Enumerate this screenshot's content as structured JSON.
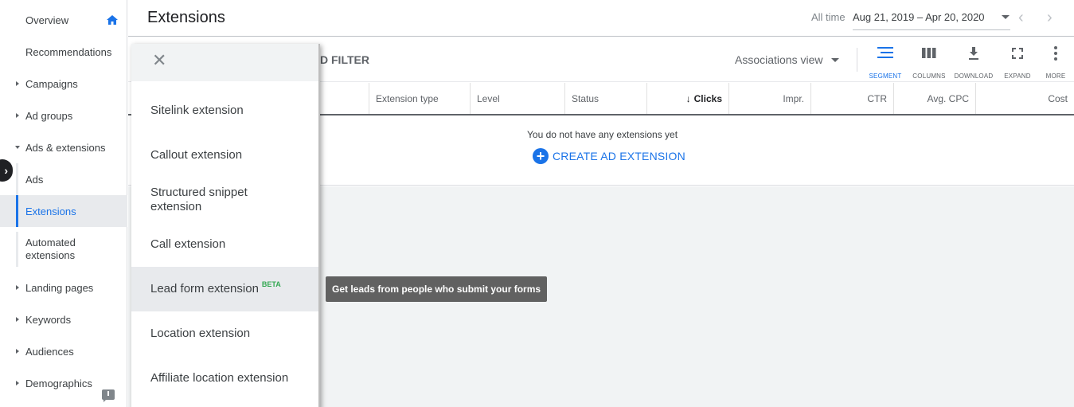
{
  "nav": {
    "items": [
      {
        "label": "Overview"
      },
      {
        "label": "Recommendations"
      },
      {
        "label": "Campaigns"
      },
      {
        "label": "Ad groups"
      },
      {
        "label": "Ads & extensions"
      },
      {
        "label": "Ads"
      },
      {
        "label": "Extensions"
      },
      {
        "label": "Automated extensions"
      },
      {
        "label": "Landing pages"
      },
      {
        "label": "Keywords"
      },
      {
        "label": "Audiences"
      },
      {
        "label": "Demographics"
      }
    ]
  },
  "header": {
    "title": "Extensions",
    "date_label": "All time",
    "date_range": "Aug 21, 2019 – Apr 20, 2020"
  },
  "toolbar": {
    "filter_label": "D FILTER",
    "associations_view": "Associations view",
    "buttons": [
      {
        "label": "SEGMENT",
        "icon": "segment-icon"
      },
      {
        "label": "COLUMNS",
        "icon": "columns-icon"
      },
      {
        "label": "DOWNLOAD",
        "icon": "download-icon"
      },
      {
        "label": "EXPAND",
        "icon": "expand-icon"
      },
      {
        "label": "MORE",
        "icon": "more-vert-icon"
      }
    ]
  },
  "table": {
    "columns": [
      "Extension type",
      "Level",
      "Status",
      "Clicks",
      "Impr.",
      "CTR",
      "Avg. CPC",
      "Cost"
    ],
    "sorted_column": "Clicks",
    "empty_text": "You do not have any extensions yet",
    "create_label": "CREATE AD EXTENSION"
  },
  "panel": {
    "options": [
      {
        "label": "Sitelink extension"
      },
      {
        "label": "Callout extension"
      },
      {
        "label": "Structured snippet extension"
      },
      {
        "label": "Call extension"
      },
      {
        "label": "Lead form extension",
        "badge": "BETA"
      },
      {
        "label": "Location extension"
      },
      {
        "label": "Affiliate location extension"
      }
    ]
  },
  "tooltip": "Get leads from people who submit your forms",
  "colors": {
    "accent": "#1a73e8",
    "beta": "#34a853",
    "tooltip_bg": "#616161"
  }
}
